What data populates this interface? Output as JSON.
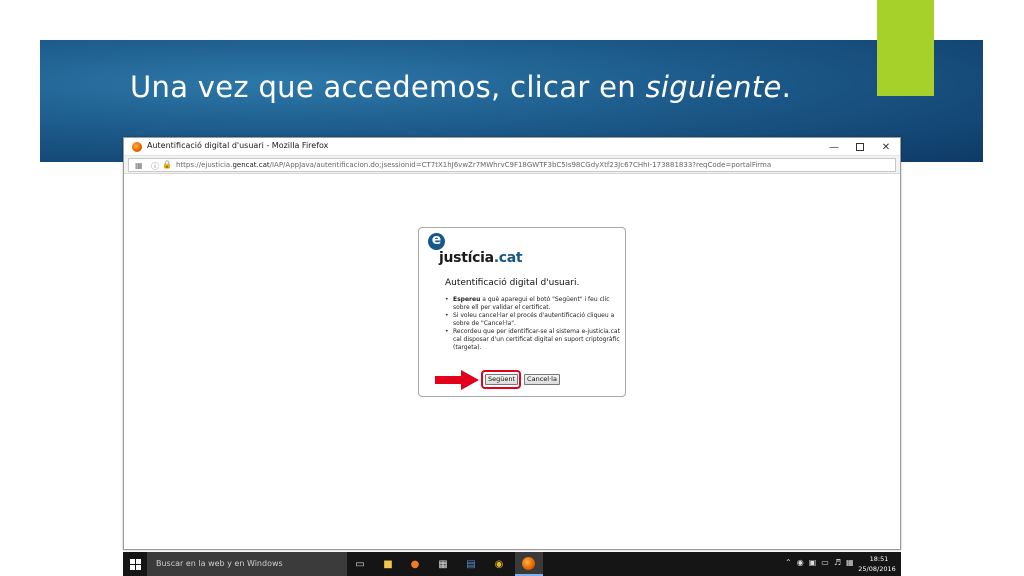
{
  "slide": {
    "title_main": "Una vez que accedemos, clicar en ",
    "title_emph": "siguiente",
    "title_end": ".",
    "accent_color": "#a6d12a",
    "banner_color": "#1c5a8a"
  },
  "browser": {
    "window_title": "Autentificació digital d'usuari - Mozilla Firefox",
    "url_prefix": "https://ejusticia.",
    "url_domain": "gencat.cat",
    "url_rest": "/IAP/AppJava/autentificacion.do;jsessionid=CT7tX1hJ6vwZr7MWhrvC9F18GWTF3bC5Is98CGdyXtf23Jc67CHhI-173881833?reqCode=portalFirma",
    "minimize_icon": "minimize-icon",
    "maximize_icon": "maximize-icon",
    "close_icon": "close-icon"
  },
  "auth": {
    "logo_e": "e",
    "logo_main": "justícia",
    "logo_suffix": ".cat",
    "heading": "Autentificació digital d'usuari.",
    "items": [
      {
        "bold": "Espereu",
        "text": " a què aparegui el botó \"Següent\" i feu clic sobre ell per validar el certificat."
      },
      {
        "bold": "",
        "text": "Si voleu cancel·lar el procés d'autentificació cliqueu a sobre de \"Cancel·la\"."
      },
      {
        "bold": "",
        "text": "Recordeu que per identificar-se al sistema e-justicia.cat cal disposar d'un certificat digital en suport criptogràfic (targeta)."
      }
    ],
    "next_label": "Següent",
    "cancel_label": "Cancel·la",
    "highlight_color": "#e2001a"
  },
  "taskbar": {
    "search_placeholder": "Buscar en la web y en Windows",
    "time": "18:51",
    "date": "25/08/2016"
  }
}
